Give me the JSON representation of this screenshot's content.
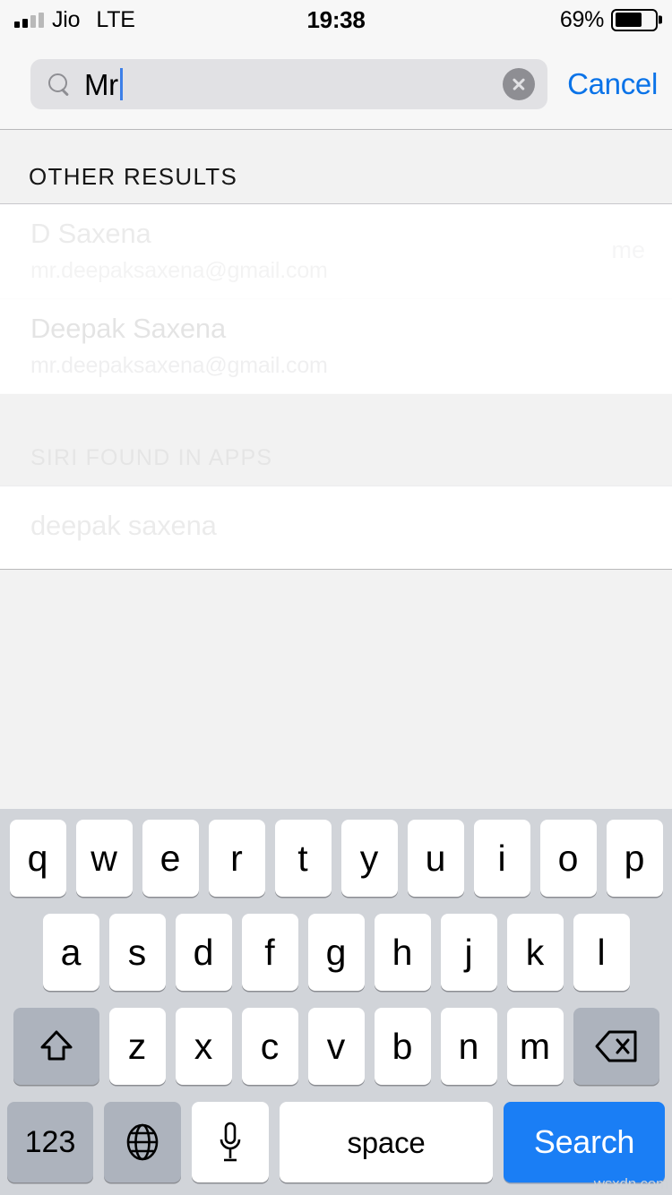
{
  "status_bar": {
    "carrier": "Jio",
    "network": "LTE",
    "time": "19:38",
    "battery_percent": "69%",
    "battery_level": 69,
    "signal_bars_filled": 2,
    "signal_bars_total": 4
  },
  "search": {
    "value": "Mr",
    "placeholder": "Search",
    "cancel_label": "Cancel",
    "search_icon": "search-icon",
    "clear_icon": "clear-circle-icon",
    "caret_color": "#3d7fe8",
    "cancel_color": "#0a73e8"
  },
  "results": {
    "sections": [
      {
        "header": "OTHER RESULTS",
        "rows": [
          {
            "title": "D Saxena",
            "subtitle": "mr.deepaksaxena@gmail.com",
            "badge": "me"
          },
          {
            "title": "Deepak Saxena",
            "subtitle": "mr.deepaksaxena@gmail.com",
            "badge": ""
          }
        ]
      },
      {
        "header": "SIRI FOUND IN APPS",
        "rows": [
          {
            "title": "deepak saxena",
            "subtitle": "",
            "badge": ""
          }
        ]
      }
    ]
  },
  "keyboard": {
    "row1": [
      "q",
      "w",
      "e",
      "r",
      "t",
      "y",
      "u",
      "i",
      "o",
      "p"
    ],
    "row2": [
      "a",
      "s",
      "d",
      "f",
      "g",
      "h",
      "j",
      "k",
      "l"
    ],
    "row3": [
      "z",
      "x",
      "c",
      "v",
      "b",
      "n",
      "m"
    ],
    "shift_icon": "shift-icon",
    "delete_icon": "delete-backspace-icon",
    "numbers_label": "123",
    "globe_icon": "globe-icon",
    "mic_icon": "microphone-icon",
    "space_label": "space",
    "search_label": "Search",
    "search_key_color": "#1a7ef5"
  },
  "watermark": "wsxdn.com"
}
